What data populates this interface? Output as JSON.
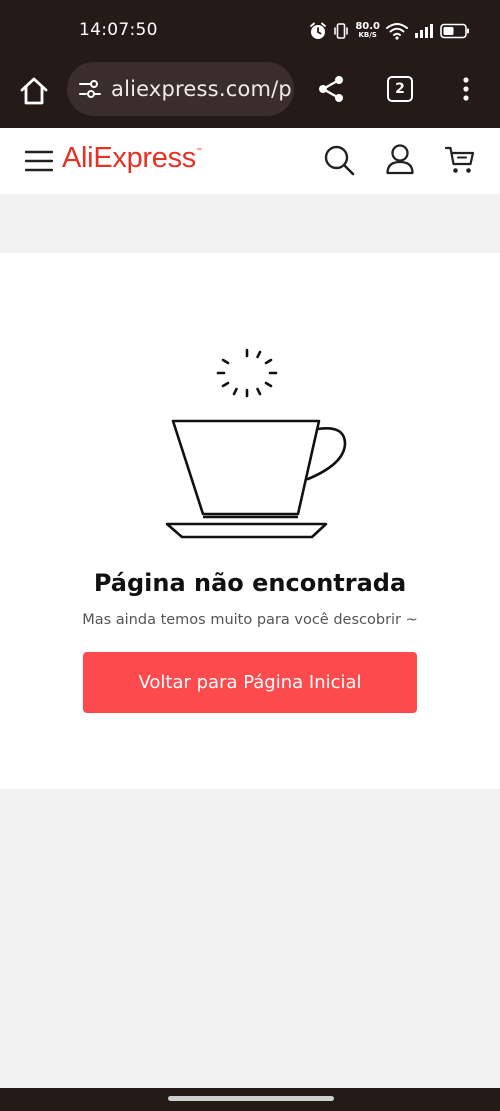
{
  "status_bar": {
    "time": "14:07:50",
    "net_speed_value": "80.0",
    "net_speed_unit": "KB/S",
    "icons": [
      "alarm-icon",
      "vibrate-icon",
      "wifi-icon",
      "signal-icon",
      "battery-icon"
    ]
  },
  "browser": {
    "url": "aliexpress.com/p",
    "tab_count": "2",
    "icons": [
      "home-icon",
      "site-settings-icon",
      "share-icon",
      "more-vert-icon"
    ]
  },
  "site_header": {
    "logo_text": "AliExpress",
    "logo_tm": "™",
    "icons": [
      "hamburger-menu-icon",
      "search-icon",
      "account-icon",
      "cart-icon"
    ]
  },
  "not_found": {
    "illustration": "coffee-cup-icon",
    "title": "Página não encontrada",
    "subtitle": "Mas ainda temos muito para você descobrir ~",
    "button_label": "Voltar para Página Inicial"
  },
  "colors": {
    "chrome_bg": "#241a17",
    "brand_red": "#e43225",
    "cta_red": "#fd4b4d",
    "page_bg": "#f2f2f2"
  }
}
